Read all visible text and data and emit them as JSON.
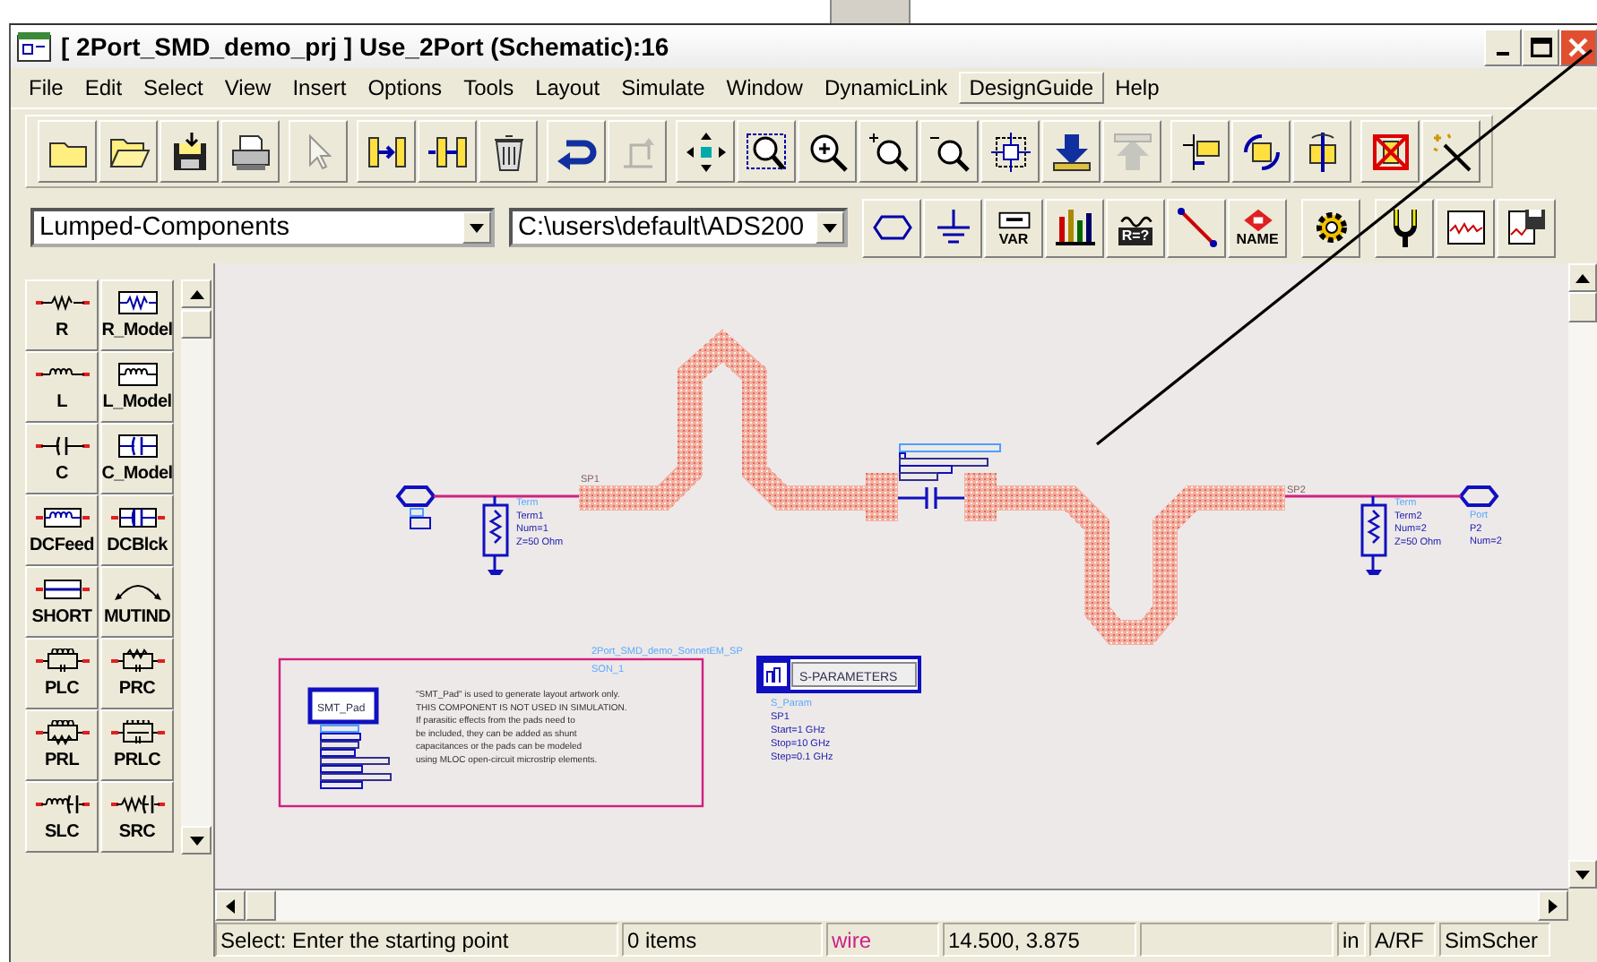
{
  "window": {
    "title": "[ 2Port_SMD_demo_prj ] Use_2Port (Schematic):16"
  },
  "menu": [
    {
      "label": "File",
      "hovered": false
    },
    {
      "label": "Edit",
      "hovered": false
    },
    {
      "label": "Select",
      "hovered": false
    },
    {
      "label": "View",
      "hovered": false
    },
    {
      "label": "Insert",
      "hovered": false
    },
    {
      "label": "Options",
      "hovered": false
    },
    {
      "label": "Tools",
      "hovered": false
    },
    {
      "label": "Layout",
      "hovered": false
    },
    {
      "label": "Simulate",
      "hovered": false
    },
    {
      "label": "Window",
      "hovered": false
    },
    {
      "label": "DynamicLink",
      "hovered": false
    },
    {
      "label": "DesignGuide",
      "hovered": true
    },
    {
      "label": "Help",
      "hovered": false
    }
  ],
  "toolbar": [
    [
      {
        "kind": "new",
        "disabled": false
      },
      {
        "kind": "open",
        "disabled": false
      },
      {
        "kind": "save",
        "disabled": false
      },
      {
        "kind": "print",
        "disabled": false
      }
    ],
    [
      {
        "kind": "pointer",
        "disabled": true
      }
    ],
    [
      {
        "kind": "insert",
        "disabled": false
      },
      {
        "kind": "insert2",
        "disabled": false
      },
      {
        "kind": "delete",
        "disabled": false
      }
    ],
    [
      {
        "kind": "undo",
        "disabled": false
      },
      {
        "kind": "redo",
        "disabled": true
      }
    ],
    [
      {
        "kind": "move",
        "disabled": false
      },
      {
        "kind": "zoombox",
        "disabled": false
      },
      {
        "kind": "zoomin",
        "disabled": false
      },
      {
        "kind": "zoomplus",
        "disabled": false
      },
      {
        "kind": "zoomminus",
        "disabled": false
      },
      {
        "kind": "fit",
        "disabled": false
      },
      {
        "kind": "push",
        "disabled": false
      },
      {
        "kind": "pop",
        "disabled": true
      }
    ],
    [
      {
        "kind": "flag",
        "disabled": false
      },
      {
        "kind": "rotate",
        "disabled": false
      },
      {
        "kind": "mirror",
        "disabled": false
      }
    ],
    [
      {
        "kind": "crossed",
        "disabled": false
      },
      {
        "kind": "wand",
        "disabled": false
      }
    ]
  ],
  "toolbar2": {
    "library": "Lumped-Components",
    "path": "C:\\users\\default\\ADS200",
    "groups": [
      [
        {
          "kind": "port"
        },
        {
          "kind": "ground"
        },
        {
          "kind": "var",
          "label": "VAR"
        },
        {
          "kind": "chart"
        },
        {
          "kind": "eqn",
          "label": "R=?"
        },
        {
          "kind": "line"
        },
        {
          "kind": "name",
          "label": "NAME"
        }
      ],
      [
        {
          "kind": "gear"
        }
      ],
      [
        {
          "kind": "tune"
        },
        {
          "kind": "wave"
        },
        {
          "kind": "plotsave"
        }
      ]
    ]
  },
  "palette": [
    {
      "label": "R",
      "kind": "resistor"
    },
    {
      "label": "R_Model",
      "kind": "resistor-model"
    },
    {
      "label": "L",
      "kind": "inductor"
    },
    {
      "label": "L_Model",
      "kind": "inductor-model"
    },
    {
      "label": "C",
      "kind": "capacitor"
    },
    {
      "label": "C_Model",
      "kind": "capacitor-model"
    },
    {
      "label": "DCFeed",
      "kind": "dc-feed"
    },
    {
      "label": "DCBlck",
      "kind": "dc-block"
    },
    {
      "label": "SHORT",
      "kind": "short"
    },
    {
      "label": "MUTIND",
      "kind": "mutual"
    },
    {
      "label": "PLC",
      "kind": "plc"
    },
    {
      "label": "PRC",
      "kind": "prc"
    },
    {
      "label": "PRL",
      "kind": "prl"
    },
    {
      "label": "PRLC",
      "kind": "prlc"
    },
    {
      "label": "SLC",
      "kind": "slc"
    },
    {
      "label": "SRC",
      "kind": "src"
    }
  ],
  "schematic": {
    "pin_labels": [
      "SP1",
      "SP2"
    ],
    "terminals": [
      {
        "lines": [
          "Term",
          "Term1",
          "Num=1",
          "Z=50 Ohm"
        ]
      },
      {
        "lines": [
          "Term",
          "Term2",
          "Num=2",
          "Z=50 Ohm"
        ]
      }
    ],
    "port": {
      "lines": [
        "Port",
        "P2",
        "Num=2"
      ]
    },
    "pad": {
      "label": "SMT_Pad",
      "note": [
        "\"SMT_Pad\" is used to generate layout artwork only.",
        "THIS COMPONENT IS NOT USED IN SIMULATION.",
        "If parasitic effects from the pads need to",
        "be included, they can be added as shunt",
        "capacitances or the pads can be modeled",
        "using MLOC open-circuit microstrip elements."
      ]
    },
    "sonnet": {
      "lines": [
        "2Port_SMD_demo_SonnetEM_SP",
        "SON_1"
      ]
    },
    "sparams": {
      "title": "S-PARAMETERS",
      "lines": [
        "S_Param",
        "SP1",
        "Start=1 GHz",
        "Stop=10 GHz",
        "Step=0.1 GHz"
      ]
    }
  },
  "status_bar": [
    {
      "kind": "text",
      "text": "Select: Enter the starting point"
    },
    {
      "kind": "text",
      "text": "0 items"
    },
    {
      "kind": "text",
      "text": "wire",
      "color": "#cc2288"
    },
    {
      "kind": "text",
      "text": "14.500, 3.875"
    },
    {
      "kind": "blank"
    },
    {
      "kind": "text",
      "text": "in"
    },
    {
      "kind": "text",
      "text": "A/RF"
    },
    {
      "kind": "text",
      "text": "SimScher"
    }
  ]
}
